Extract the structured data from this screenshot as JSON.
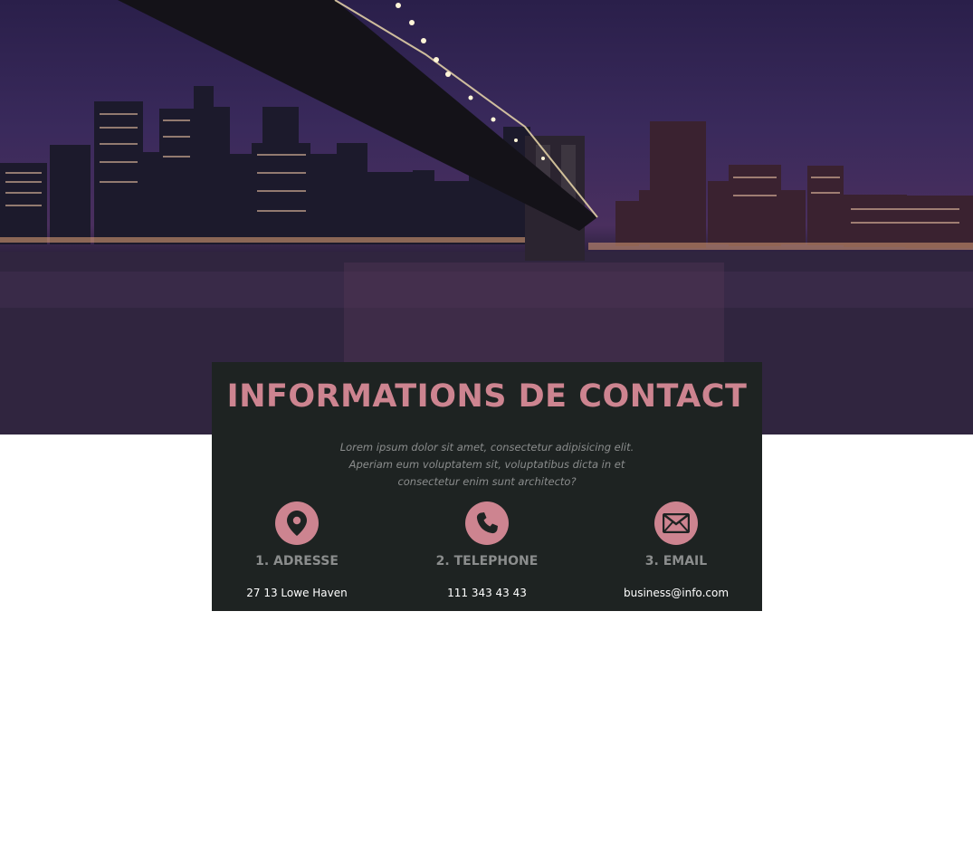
{
  "hero": {
    "image": "night-city-bridge-skyline"
  },
  "contact": {
    "title": "INFORMATIONS DE CONTACT",
    "description": "Lorem ipsum dolor sit amet, consectetur adipisicing elit. Aperiam eum voluptatem sit, voluptatibus dicta in et consectetur enim sunt architecto?",
    "items": [
      {
        "icon": "map-pin-icon",
        "label": "1. ADRESSE",
        "value": "27 13 Lowe Haven"
      },
      {
        "icon": "phone-icon",
        "label": "2. TELEPHONE",
        "value": "111 343 43 43"
      },
      {
        "icon": "envelope-icon",
        "label": "3. EMAIL",
        "value": "business@info.com"
      }
    ]
  },
  "colors": {
    "accent": "#cd8490",
    "card_bg": "#1e2322",
    "muted_text": "#8b8d8d"
  }
}
